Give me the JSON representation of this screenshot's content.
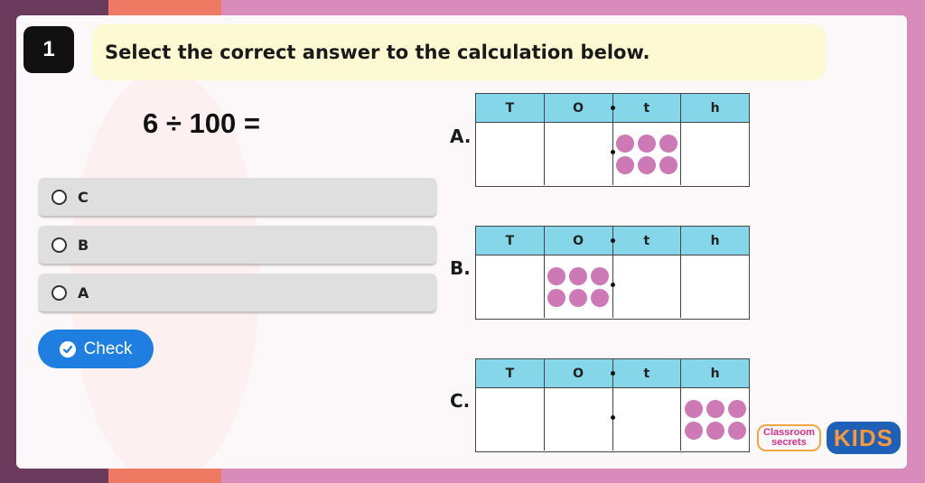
{
  "question": {
    "number": "1",
    "instruction": "Select the correct answer to the calculation below.",
    "calculation": "6 ÷ 100 ="
  },
  "options": [
    {
      "label": "C"
    },
    {
      "label": "B"
    },
    {
      "label": "A"
    }
  ],
  "check_button": {
    "label": "Check"
  },
  "place_value": {
    "headers": [
      "T",
      "O",
      "t",
      "h"
    ],
    "charts": [
      {
        "label": "A.",
        "counters": 6,
        "column_index": 2
      },
      {
        "label": "B.",
        "counters": 6,
        "column_index": 1
      },
      {
        "label": "C.",
        "counters": 6,
        "column_index": 3
      }
    ]
  },
  "logo": {
    "brand_line1": "Classroom",
    "brand_line2": "secrets",
    "kids": "KIDS"
  },
  "colors": {
    "check_button": "#1e7fe0",
    "counter": "#cc79b6",
    "table_header": "#85d6e8",
    "banner": "#fdf9d3"
  }
}
